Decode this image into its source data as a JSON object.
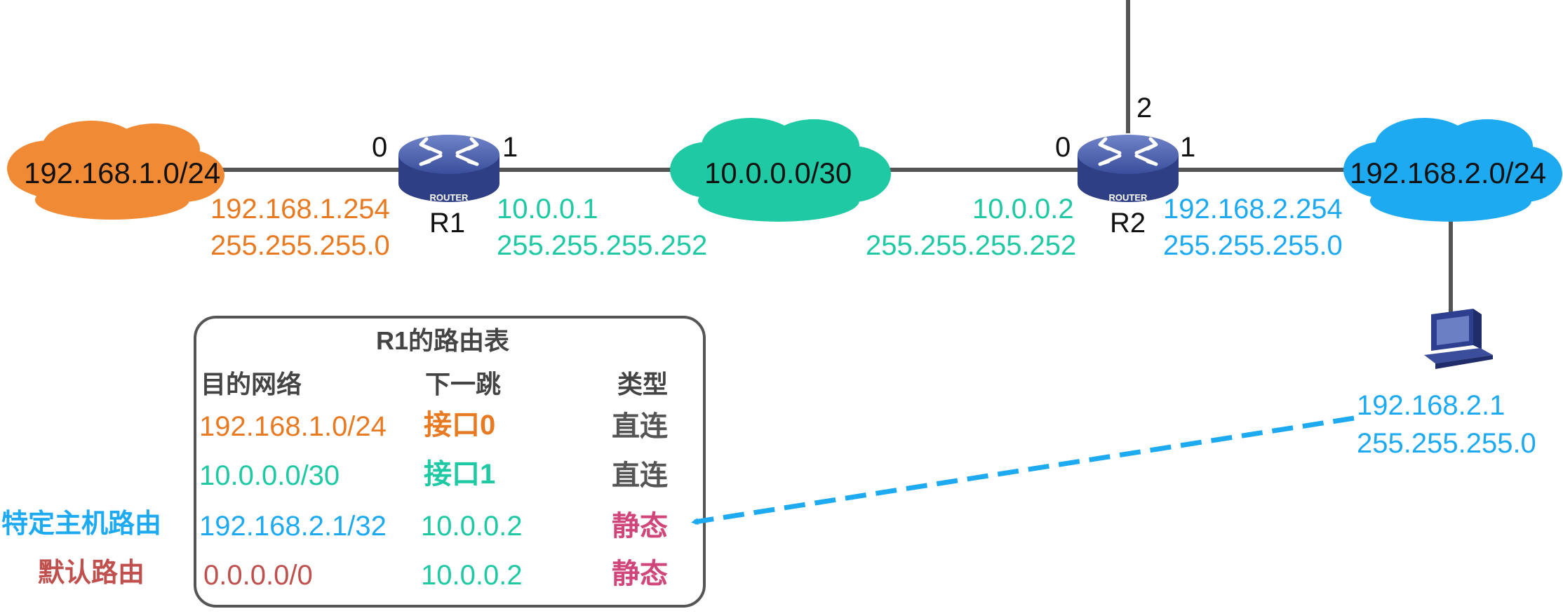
{
  "colors": {
    "orange": "#e87a22",
    "teal": "#1ec9a3",
    "blue": "#1eaaf1",
    "link": "#555555",
    "router_body": "#3b4e9c",
    "static_pink": "#d0457a",
    "default_red": "#c0504d",
    "host_blue": "#2d3f8e"
  },
  "networks": {
    "left": "192.168.1.0/24",
    "middle": "10.0.0.0/30",
    "right": "192.168.2.0/24"
  },
  "routers": {
    "r1": {
      "name": "R1",
      "badge": "ROUTER",
      "port0": "0",
      "port1": "1",
      "if0_ip": "192.168.1.254",
      "if0_mask": "255.255.255.0",
      "if1_ip": "10.0.0.1",
      "if1_mask": "255.255.255.252"
    },
    "r2": {
      "name": "R2",
      "badge": "ROUTER",
      "port0": "0",
      "port1": "1",
      "port2": "2",
      "if0_ip": "10.0.0.2",
      "if0_mask": "255.255.255.252",
      "if1_ip": "192.168.2.254",
      "if1_mask": "255.255.255.0"
    }
  },
  "host": {
    "icon": "computer-icon",
    "ip": "192.168.2.1",
    "mask": "255.255.255.0"
  },
  "table": {
    "title": "R1的路由表",
    "headers": {
      "dest": "目的网络",
      "next": "下一跳",
      "type": "类型"
    },
    "rows": [
      {
        "side": "",
        "dest": "192.168.1.0/24",
        "next": "接口0",
        "type": "直连"
      },
      {
        "side": "",
        "dest": "10.0.0.0/30",
        "next": "接口1",
        "type": "直连"
      },
      {
        "side": "特定主机路由",
        "dest": "192.168.2.1/32",
        "next": "10.0.0.2",
        "type": "静态"
      },
      {
        "side": "默认路由",
        "dest": "0.0.0.0/0",
        "next": "10.0.0.2",
        "type": "静态"
      }
    ]
  }
}
